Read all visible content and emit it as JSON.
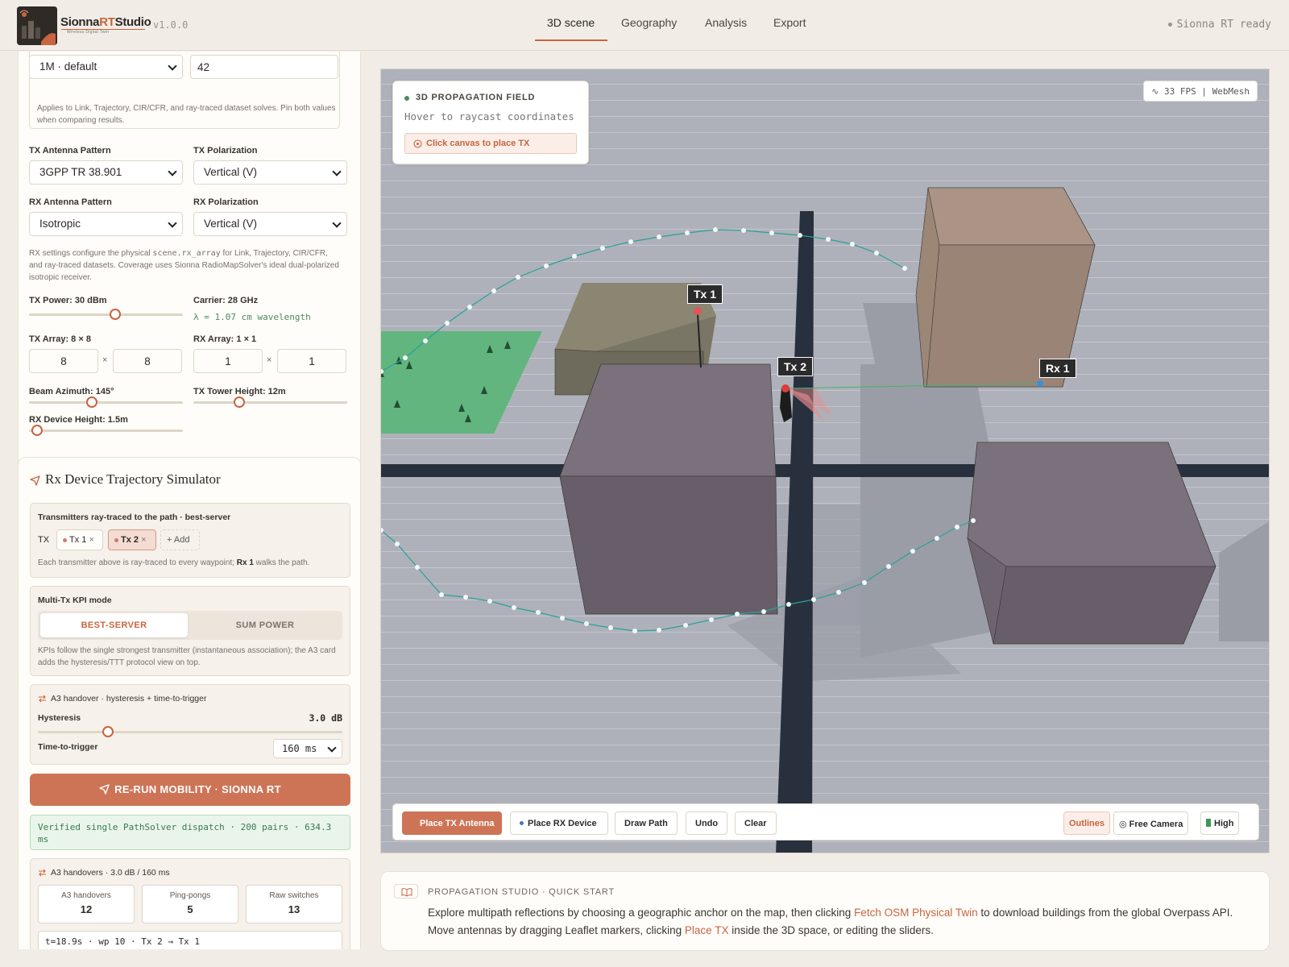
{
  "header": {
    "brand_a": "Sionna",
    "brand_b": "RT",
    "brand_c": "Studio",
    "brand_sub": "Wireless Digital Twin",
    "version": "v1.0.0",
    "tabs": [
      "3D scene",
      "Geography",
      "Analysis",
      "Export"
    ],
    "active_tab": "3D scene",
    "status": "Sionna RT ready"
  },
  "settings": {
    "seed_select": "1M · default",
    "seed_value": "42",
    "seed_note": "Applies to Link, Trajectory, CIR/CFR, and ray-traced dataset solves. Pin both values when comparing results.",
    "tx_pattern_label": "TX Antenna Pattern",
    "tx_pattern": "3GPP TR 38.901",
    "tx_pol_label": "TX Polarization",
    "tx_pol": "Vertical (V)",
    "rx_pattern_label": "RX Antenna Pattern",
    "rx_pattern": "Isotropic",
    "rx_pol_label": "RX Polarization",
    "rx_pol": "Vertical (V)",
    "rx_note_a": "RX settings configure the physical ",
    "rx_note_code": "scene.rx_array",
    "rx_note_b": " for Link, Trajectory, CIR/CFR, and ray-traced datasets. Coverage uses Sionna RadioMapSolver's ideal dual-polarized isotropic receiver.",
    "tx_power_label": "TX Power: 30 dBm",
    "tx_power_fraction": 0.56,
    "carrier_label": "Carrier: 28 GHz",
    "wavelength": "λ = 1.07 cm wavelength",
    "tx_array_label": "TX Array: 8 × 8",
    "tx_array": [
      "8",
      "8"
    ],
    "rx_array_label": "RX Array: 1 × 1",
    "rx_array": [
      "1",
      "1"
    ],
    "times": "×",
    "beam_azimuth_label": "Beam Azimuth: 145°",
    "beam_azimuth_fraction": 0.41,
    "tower_height_label": "TX Tower Height: 12m",
    "tower_height_fraction": 0.3,
    "rx_height_label": "RX Device Height: 1.5m",
    "rx_height_fraction": 0.05
  },
  "trajectory": {
    "title": "Rx Device Trajectory Simulator",
    "tx_section_title": "Transmitters ray-traced to the path · best-server",
    "tx_label": "TX",
    "tx_chips": [
      "Tx 1",
      "Tx 2"
    ],
    "chip_close": "×",
    "add_label": "+ Add",
    "tx_note_a": "Each transmitter above is ray-traced to every waypoint; ",
    "tx_note_bold": "Rx 1",
    "tx_note_b": " walks the path.",
    "kpi_title": "Multi-Tx KPI mode",
    "kpi_modes": [
      "BEST-SERVER",
      "SUM POWER"
    ],
    "kpi_active": "BEST-SERVER",
    "kpi_note": "KPIs follow the single strongest transmitter (instantaneous association); the A3 card adds the hysteresis/TTT protocol view on top.",
    "a3_title": "A3 handover · hysteresis + time-to-trigger",
    "hysteresis_label": "Hysteresis",
    "hysteresis_value": "3.0 dB",
    "hysteresis_fraction": 0.23,
    "ttt_label": "Time-to-trigger",
    "ttt_value": "160 ms",
    "rerun_label": "RE-RUN MOBILITY · SIONNA RT",
    "verified": "Verified single PathSolver dispatch · 200 pairs · 634.3 ms",
    "handover_title": "A3 handovers · 3.0 dB / 160 ms",
    "stats": [
      {
        "title": "A3 handovers",
        "value": "12"
      },
      {
        "title": "Ping-pongs",
        "value": "5"
      },
      {
        "title": "Raw switches",
        "value": "13"
      }
    ],
    "log_line": "t=18.9s · wp 10 · Tx 2 → Tx 1"
  },
  "viewport": {
    "field_title": "3D PROPAGATION FIELD",
    "field_hint": "Hover to raycast coordinates",
    "field_action": "Click canvas to place TX",
    "fps": "33 FPS | WebMesh",
    "markers": [
      "Tx 1",
      "Tx 2",
      "Rx 1"
    ],
    "colors": {
      "accent": "#cd7457",
      "path": "#2aa198",
      "ground": "#acafb8"
    },
    "toolbar": {
      "place_tx": "Place TX Antenna",
      "place_rx": "Place RX Device",
      "draw_path": "Draw Path",
      "undo": "Undo",
      "clear": "Clear",
      "outlines": "Outlines",
      "free_camera": "Free Camera",
      "quality": "High"
    }
  },
  "quickstart": {
    "title": "PROPAGATION STUDIO · QUICK START",
    "text_a": "Explore multipath reflections by choosing a geographic anchor on the map, then clicking ",
    "link_a": "Fetch OSM Physical Twin",
    "text_b": " to download buildings from the global Overpass API. Move antennas by dragging Leaflet markers, clicking ",
    "link_b": "Place TX",
    "text_c": " inside the 3D space, or editing the sliders."
  }
}
